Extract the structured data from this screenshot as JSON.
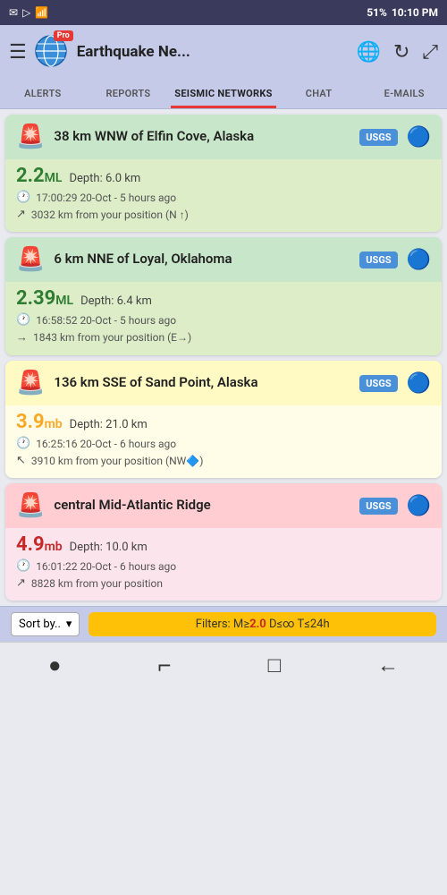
{
  "statusBar": {
    "leftIcons": [
      "✉",
      "▷",
      "📶"
    ],
    "battery": "51%",
    "time": "10:10 PM"
  },
  "header": {
    "title": "Earthquake Ne...",
    "pro_badge": "Pro"
  },
  "tabs": [
    {
      "id": "alerts",
      "label": "ALERTS",
      "active": false
    },
    {
      "id": "reports",
      "label": "REPORTS",
      "active": false
    },
    {
      "id": "seismic",
      "label": "SEISMIC NETWORKS",
      "active": true
    },
    {
      "id": "chat",
      "label": "CHAT",
      "active": false
    },
    {
      "id": "emails",
      "label": "E-MAILS",
      "active": false
    }
  ],
  "earthquakes": [
    {
      "id": 1,
      "theme": "green",
      "title": "38 km WNW of Elfin Cove, Alaska",
      "source": "USGS",
      "magnitude": "2.2",
      "magType": "ML",
      "depth": "Depth: 6.0 km",
      "time": "17:00:29 20-Oct - 5 hours ago",
      "distance": "3032 km from your position (N ↑)"
    },
    {
      "id": 2,
      "theme": "green",
      "title": "6 km NNE of Loyal, Oklahoma",
      "source": "USGS",
      "magnitude": "2.39",
      "magType": "ML",
      "depth": "Depth: 6.4 km",
      "time": "16:58:52 20-Oct - 5 hours ago",
      "distance": "1843 km from your position (E→)"
    },
    {
      "id": 3,
      "theme": "yellow",
      "title": "136 km SSE of Sand Point, Alaska",
      "source": "USGS",
      "magnitude": "3.9",
      "magType": "mb",
      "depth": "Depth: 21.0 km",
      "time": "16:25:16 20-Oct - 6 hours ago",
      "distance": "3910 km from your position (NW🔷)"
    },
    {
      "id": 4,
      "theme": "pink",
      "title": "central Mid-Atlantic Ridge",
      "source": "USGS",
      "magnitude": "4.9",
      "magType": "mb",
      "depth": "Depth: 10.0 km",
      "time": "16:01:22 20-Oct - 6 hours ago",
      "distance": "8828 km from your position"
    }
  ],
  "sortBy": {
    "label": "Sort by..",
    "arrow": "▾"
  },
  "filters": {
    "label": "Filters: M≥",
    "magnitude": "2.0",
    "rest": "D≤∞ T≤24h"
  },
  "nav": {
    "icons": [
      "●",
      "↵",
      "□",
      "←"
    ]
  }
}
